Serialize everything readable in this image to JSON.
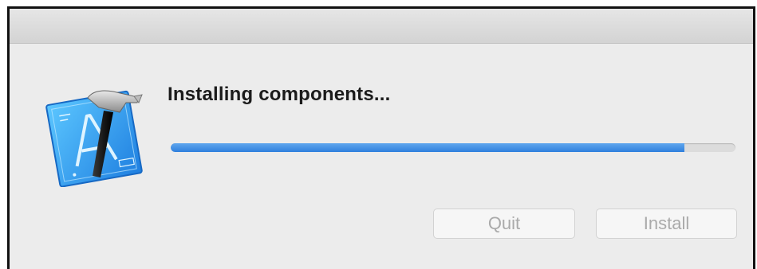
{
  "dialog": {
    "status_text": "Installing components...",
    "progress": 0.91,
    "progress_color": "#3c8ae3",
    "buttons": {
      "quit_label": "Quit",
      "install_label": "Install"
    },
    "icon": "xcode-blueprint-hammer-icon"
  }
}
